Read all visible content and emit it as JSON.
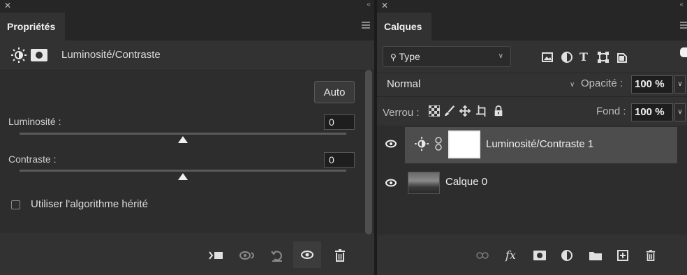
{
  "properties_panel": {
    "tab_label": "Propriétés",
    "header_title": "Luminosité/Contraste",
    "auto_label": "Auto",
    "brightness": {
      "label": "Luminosité :",
      "value": "0",
      "slider_fraction": 0.5
    },
    "contrast": {
      "label": "Contraste :",
      "value": "0",
      "slider_fraction": 0.5
    },
    "legacy_checkbox": {
      "label": "Utiliser l'algorithme hérité",
      "checked": false
    }
  },
  "layers_panel": {
    "tab_label": "Calques",
    "filter_type": "Type",
    "blend_mode": "Normal",
    "opacity_label": "Opacité :",
    "opacity_value": "100 %",
    "lock_label": "Verrou :",
    "fill_label": "Fond :",
    "fill_value": "100 %",
    "layers": [
      {
        "name": "Luminosité/Contraste 1",
        "selected": true
      },
      {
        "name": "Calque 0",
        "selected": false
      }
    ]
  },
  "colors": {
    "panel_bg": "#323232",
    "selected_row": "#4d4d4d",
    "accent_text": "#f0f0f0"
  }
}
